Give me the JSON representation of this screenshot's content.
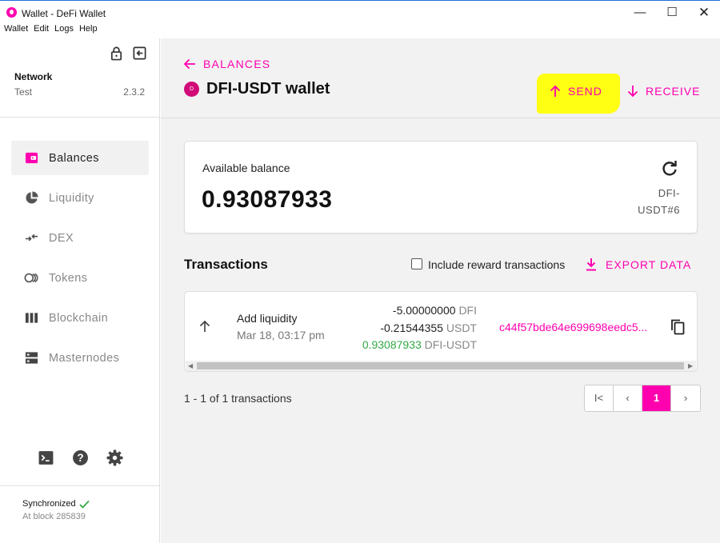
{
  "window": {
    "title": "Wallet - DeFi Wallet",
    "minimize": "—",
    "maximize": "☐",
    "close": "✕"
  },
  "menu": [
    "Wallet",
    "Edit",
    "Logs",
    "Help"
  ],
  "sidebar": {
    "network_label": "Network",
    "network_name": "Test",
    "version": "2.3.2",
    "nav": [
      {
        "label": "Balances",
        "icon": "wallet-icon",
        "active": true
      },
      {
        "label": "Liquidity",
        "icon": "pie-chart-icon",
        "active": false
      },
      {
        "label": "DEX",
        "icon": "swap-arrows-icon",
        "active": false
      },
      {
        "label": "Tokens",
        "icon": "tokens-icon",
        "active": false
      },
      {
        "label": "Blockchain",
        "icon": "blockchain-icon",
        "active": false
      },
      {
        "label": "Masternodes",
        "icon": "server-icon",
        "active": false
      }
    ],
    "sync_status": "Synchronized",
    "block": "At block 285839"
  },
  "header": {
    "back_label": "BALANCES",
    "token_badge": "D",
    "title": "DFI-USDT wallet",
    "send_label": "SEND",
    "receive_label": "RECEIVE"
  },
  "balance": {
    "label": "Available balance",
    "value": "0.93087933",
    "unit_line1": "DFI-",
    "unit_line2": "USDT#6"
  },
  "transactions": {
    "title": "Transactions",
    "include_reward_label": "Include reward transactions",
    "include_reward_checked": false,
    "export_label": "EXPORT DATA",
    "rows": [
      {
        "type": "Add liquidity",
        "date": "Mar 18, 03:17 pm",
        "amounts": [
          {
            "value": "-5.00000000",
            "unit": "DFI"
          },
          {
            "value": "-0.21544355",
            "unit": "USDT"
          },
          {
            "value": "0.93087933",
            "unit": "DFI-USDT"
          }
        ],
        "hash": "c44f57bde64e699698eedc5..."
      }
    ],
    "count_text": "1 - 1 of 1 transactions",
    "pagination": {
      "first": "I<",
      "prev": "‹",
      "current": "1",
      "next": "›"
    }
  },
  "colors": {
    "accent": "#ff00af",
    "positive": "#35a847",
    "highlight": "#ffff14"
  }
}
